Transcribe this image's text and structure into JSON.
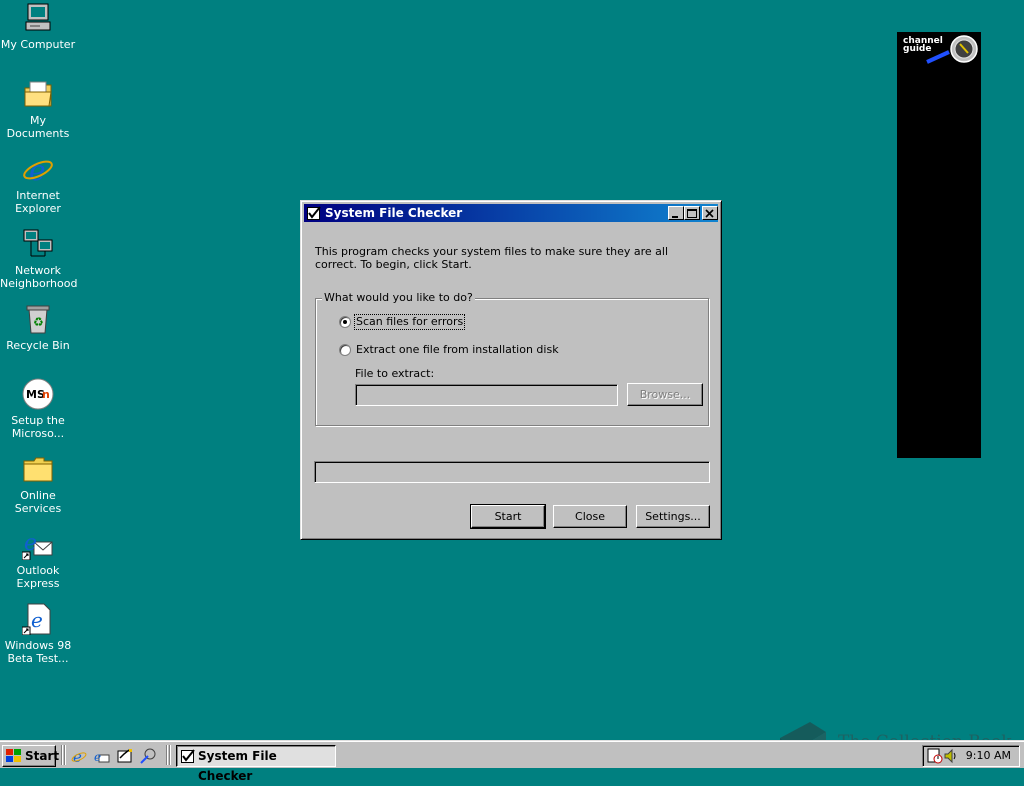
{
  "desktop": {
    "icons": [
      {
        "label": "My Computer",
        "icon": "my-computer-icon"
      },
      {
        "label": "My Documents",
        "icon": "my-documents-icon"
      },
      {
        "label": "Internet\nExplorer",
        "icon": "internet-explorer-icon"
      },
      {
        "label": "Network\nNeighborhood",
        "icon": "network-neighborhood-icon"
      },
      {
        "label": "Recycle Bin",
        "icon": "recycle-bin-icon"
      },
      {
        "label": "Setup the\nMicroso...",
        "icon": "msn-setup-icon"
      },
      {
        "label": "Online\nServices",
        "icon": "folder-icon"
      },
      {
        "label": "Outlook\nExpress",
        "icon": "outlook-express-icon"
      },
      {
        "label": "Windows 98\nBeta Test...",
        "icon": "ie-shortcut-icon"
      }
    ],
    "channel_bar": {
      "label": "channel\nguide",
      "icon": "satellite-dish-icon"
    },
    "background_color": "#008080"
  },
  "window": {
    "title": "System File Checker",
    "intro": "This program checks your system files to make sure they are all correct. To begin, click Start.",
    "group_label": "What would you like to do?",
    "options": [
      {
        "label": "Scan files for errors",
        "selected": true
      },
      {
        "label": "Extract one file from installation disk",
        "selected": false
      }
    ],
    "file_to_extract_label": "File to extract:",
    "file_to_extract_value": "",
    "browse_label": "Browse...",
    "buttons": {
      "start": "Start",
      "close": "Close",
      "settings": "Settings..."
    },
    "progress": 0
  },
  "taskbar": {
    "start_label": "Start",
    "quick_launch": [
      "internet-explorer-icon",
      "outlook-express-icon",
      "show-desktop-icon",
      "channels-icon"
    ],
    "tasks": [
      {
        "label": "System File Checker",
        "active": true
      }
    ],
    "clock": "9:10 AM"
  },
  "watermark": {
    "text": "The Collection Book"
  }
}
